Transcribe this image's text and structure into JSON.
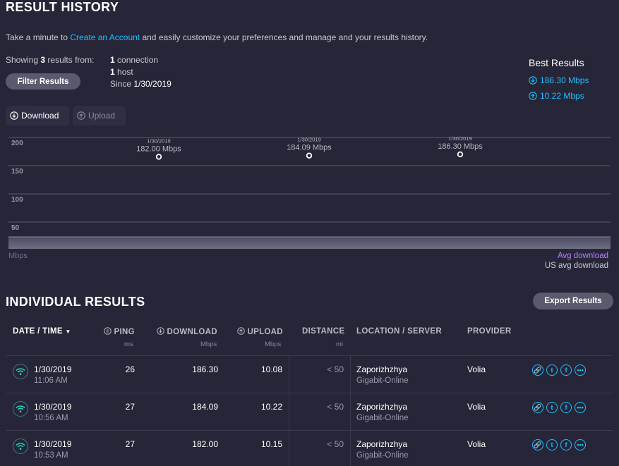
{
  "header": {
    "title": "RESULT HISTORY"
  },
  "intro": {
    "prefix": "Take a minute to ",
    "link": "Create an Account",
    "suffix": " and easily customize your preferences and manage and your results history."
  },
  "summary": {
    "showing_prefix": "Showing ",
    "count": "3",
    "showing_suffix": " results from:",
    "connections_count": "1",
    "connections_label": " connection",
    "hosts_count": "1",
    "hosts_label": " host",
    "since_label": "Since ",
    "since_date": "1/30/2019",
    "filter_button": "Filter Results"
  },
  "best_results": {
    "title": "Best Results",
    "download": "186.30 Mbps",
    "upload": "10.22 Mbps"
  },
  "tabs": {
    "download": "Download",
    "upload": "Upload"
  },
  "chart_data": {
    "type": "scatter",
    "title": "",
    "xlabel": "",
    "ylabel": "Mbps",
    "ylim": [
      0,
      200
    ],
    "yticks": [
      200,
      150,
      100,
      50
    ],
    "grid": true,
    "points": [
      {
        "date": "1/30/2019",
        "value": 182.0,
        "label": "182.00 Mbps"
      },
      {
        "date": "1/30/2019",
        "value": 184.09,
        "label": "184.09 Mbps"
      },
      {
        "date": "1/30/2019",
        "value": 186.3,
        "label": "186.30 Mbps"
      }
    ],
    "legend": [
      "Avg download",
      "US avg download"
    ]
  },
  "individual": {
    "title": "INDIVIDUAL RESULTS",
    "export_button": "Export Results",
    "columns": {
      "date": "DATE / TIME",
      "ping": "PING",
      "ping_unit": "ms",
      "download": "DOWNLOAD",
      "download_unit": "Mbps",
      "upload": "UPLOAD",
      "upload_unit": "Mbps",
      "distance": "DISTANCE",
      "distance_unit": "mi",
      "location": "LOCATION / SERVER",
      "provider": "PROVIDER"
    },
    "rows": [
      {
        "date": "1/30/2019",
        "time": "11:06 AM",
        "ping": "26",
        "download": "186.30",
        "upload": "10.08",
        "distance": "< 50",
        "location": "Zaporizhzhya",
        "server": "Gigabit-Online",
        "provider": "Volia"
      },
      {
        "date": "1/30/2019",
        "time": "10:56 AM",
        "ping": "27",
        "download": "184.09",
        "upload": "10.22",
        "distance": "< 50",
        "location": "Zaporizhzhya",
        "server": "Gigabit-Online",
        "provider": "Volia"
      },
      {
        "date": "1/30/2019",
        "time": "10:53 AM",
        "ping": "27",
        "download": "182.00",
        "upload": "10.15",
        "distance": "< 50",
        "location": "Zaporizhzhya",
        "server": "Gigabit-Online",
        "provider": "Volia"
      }
    ]
  },
  "colors": {
    "background": "#262638",
    "accent": "#1cbfff",
    "avg_download": "#b980ff",
    "wifi": "#2ad8c4"
  }
}
